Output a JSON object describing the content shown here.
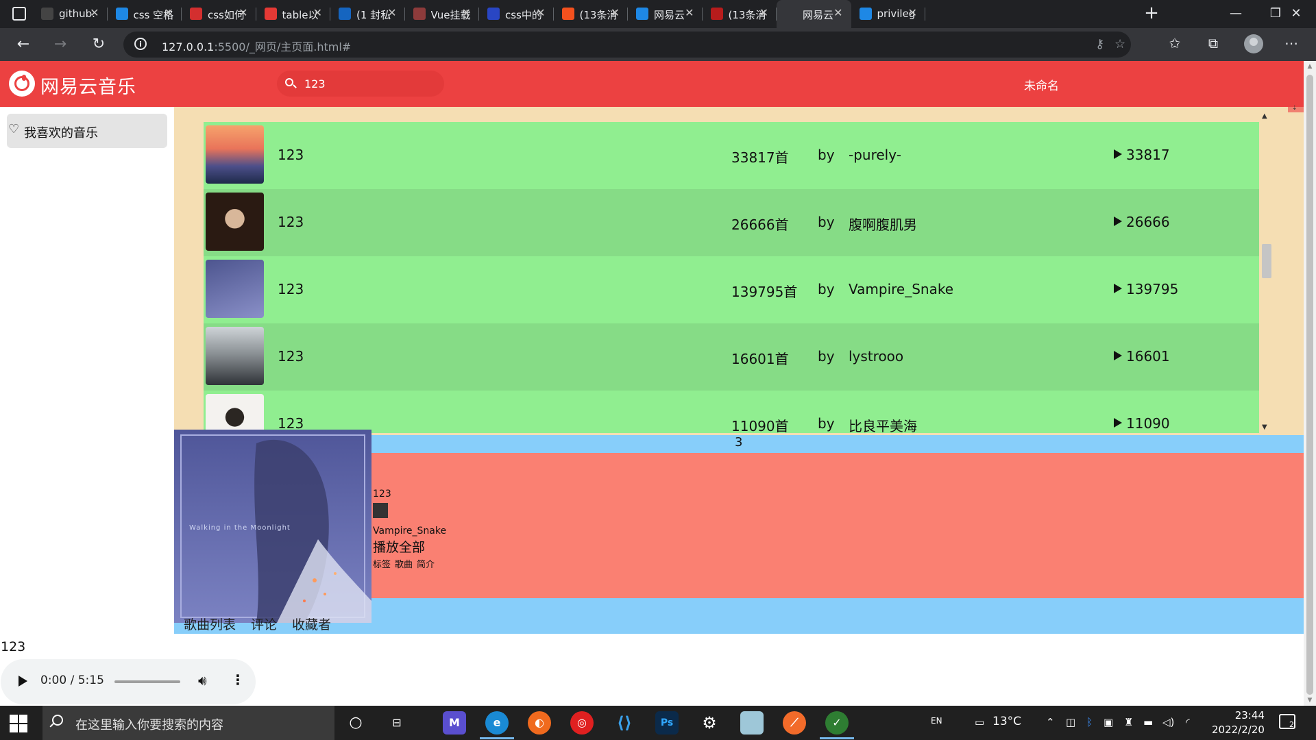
{
  "browser": {
    "tabs": [
      {
        "title": "github.",
        "color": "#444444"
      },
      {
        "title": "css 空格",
        "color": "#1e88e5"
      },
      {
        "title": "css如何",
        "color": "#d32f2f"
      },
      {
        "title": "table以",
        "color": "#e53935"
      },
      {
        "title": "(1 封私",
        "color": "#1565c0"
      },
      {
        "title": "Vue挂载",
        "color": "#8d3b3b"
      },
      {
        "title": "css中的",
        "color": "#2946c4"
      },
      {
        "title": "(13条消",
        "color": "#f4511e"
      },
      {
        "title": "网易云",
        "color": "#1e88e5"
      },
      {
        "title": "(13条消",
        "color": "#b71c1c"
      },
      {
        "title": "网易云",
        "color": "#35363a",
        "active": true
      },
      {
        "title": "privileg",
        "color": "#1e88e5"
      }
    ],
    "url_host": "127.0.0.1",
    "url_path": ":5500/_网页/主页面.html#"
  },
  "app": {
    "brand": "网易云音乐",
    "search_value": "123",
    "username": "未命名",
    "sidebar_item": "我喜欢的音乐"
  },
  "songlist": {
    "rows": [
      {
        "name": "123",
        "count": "33817首",
        "by": "by",
        "creator": "-purely-",
        "plays": "33817",
        "thumb": "sunset"
      },
      {
        "name": "123",
        "count": "26666首",
        "by": "by",
        "creator": "腹啊腹肌男",
        "plays": "26666",
        "thumb": "portrait-dark"
      },
      {
        "name": "123",
        "count": "139795首",
        "by": "by",
        "creator": "Vampire_Snake",
        "plays": "139795",
        "thumb": "blue-girl"
      },
      {
        "name": "123",
        "count": "16601首",
        "by": "by",
        "creator": "lystrooo",
        "plays": "16601",
        "thumb": "rainy-street"
      },
      {
        "name": "123",
        "count": "11090首",
        "by": "by",
        "creator": "比良平美海",
        "plays": "11090",
        "thumb": "white-portrait"
      }
    ],
    "page": "3"
  },
  "detail": {
    "cover_text": "Walking in the Moonlight",
    "title": "123",
    "creator": "Vampire_Snake",
    "play_all": "播放全部",
    "tags": [
      "标签",
      "歌曲",
      "简介"
    ],
    "tabs": [
      "歌曲列表",
      "评论",
      "收藏者"
    ]
  },
  "player": {
    "now_playing": "123",
    "time": "0:00 / 5:15"
  },
  "taskbar": {
    "search_placeholder": "在这里输入你要搜索的内容",
    "lang": "EN",
    "temperature": "13°C",
    "time": "23:44",
    "date": "2022/2/20",
    "notifications": "2"
  }
}
